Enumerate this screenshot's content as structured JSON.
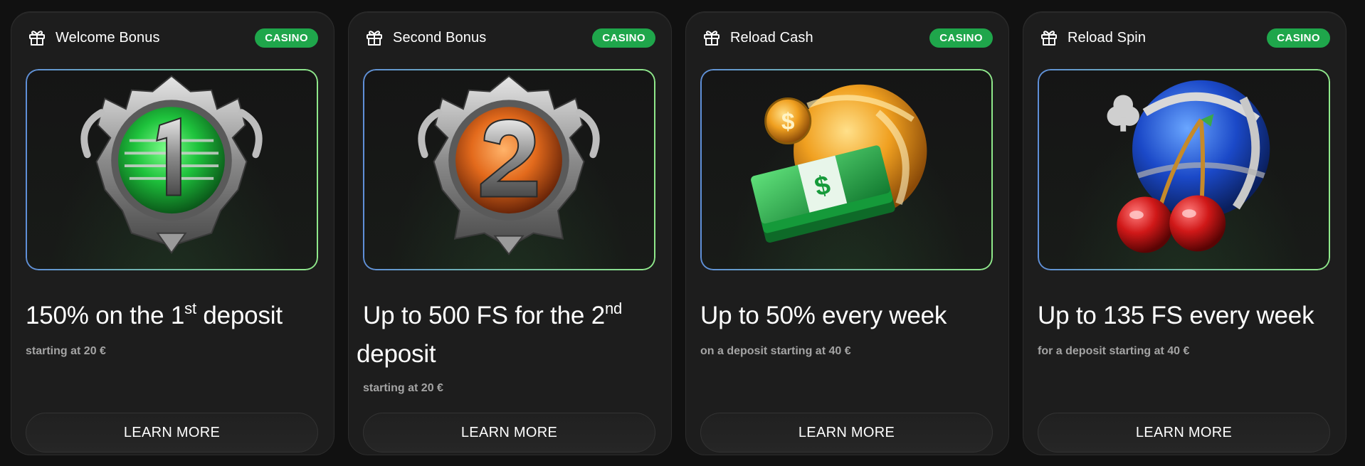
{
  "cards": [
    {
      "title": "Welcome Bonus",
      "badge": "CASINO",
      "headline_pre": "150% on the 1",
      "headline_sup": "st",
      "headline_post": " deposit",
      "subtext": "starting at 20 €",
      "button": "LEARN MORE",
      "art_icon": "green-badge-1-icon"
    },
    {
      "title": "Second Bonus",
      "badge": "CASINO",
      "headline_pre": "Up to 500 FS for the 2",
      "headline_sup": "nd",
      "headline_post": " deposit",
      "subtext": "starting at 20 €",
      "button": "LEARN MORE",
      "art_icon": "orange-badge-2-icon"
    },
    {
      "title": "Reload Cash",
      "badge": "CASINO",
      "headline": "Up to 50% every week",
      "subtext": "on a deposit starting at 40 €",
      "button": "LEARN MORE",
      "art_icon": "cash-stack-icon"
    },
    {
      "title": "Reload Spin",
      "badge": "CASINO",
      "headline": "Up to 135 FS every week",
      "subtext": "for a deposit starting at 40 €",
      "button": "LEARN MORE",
      "art_icon": "cherry-ball-icon"
    }
  ],
  "colors": {
    "background": "#111111",
    "card": "#1d1d1d",
    "badge": "#1fa64b",
    "subtext": "#a4a4a4"
  }
}
